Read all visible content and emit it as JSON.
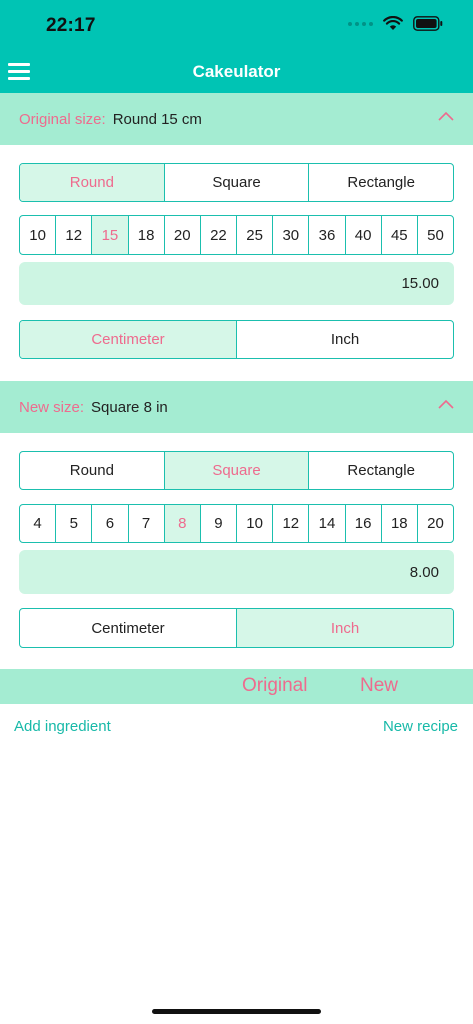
{
  "status": {
    "time": "22:17"
  },
  "app": {
    "title": "Cakeulator"
  },
  "original": {
    "label": "Original size:",
    "value": "Round 15 cm",
    "shapes": [
      "Round",
      "Square",
      "Rectangle"
    ],
    "selected_shape": 0,
    "sizes": [
      "10",
      "12",
      "15",
      "18",
      "20",
      "22",
      "25",
      "30",
      "36",
      "40",
      "45",
      "50"
    ],
    "selected_size": 2,
    "field_value": "15.00",
    "units": [
      "Centimeter",
      "Inch"
    ],
    "selected_unit": 0
  },
  "new_size": {
    "label": "New size:",
    "value": "Square 8 in",
    "shapes": [
      "Round",
      "Square",
      "Rectangle"
    ],
    "selected_shape": 1,
    "sizes": [
      "4",
      "5",
      "6",
      "7",
      "8",
      "9",
      "10",
      "12",
      "14",
      "16",
      "18",
      "20"
    ],
    "selected_size": 4,
    "field_value": "8.00",
    "units": [
      "Centimeter",
      "Inch"
    ],
    "selected_unit": 1
  },
  "results": {
    "original_label": "Original",
    "new_label": "New"
  },
  "actions": {
    "add_ingredient": "Add ingredient",
    "new_recipe": "New recipe"
  },
  "colors": {
    "teal": "#00c4b4",
    "mint": "#a4ecd2",
    "selected_bg": "#d6f7e8",
    "pink": "#ee6b8e",
    "link": "#17b9a8"
  }
}
